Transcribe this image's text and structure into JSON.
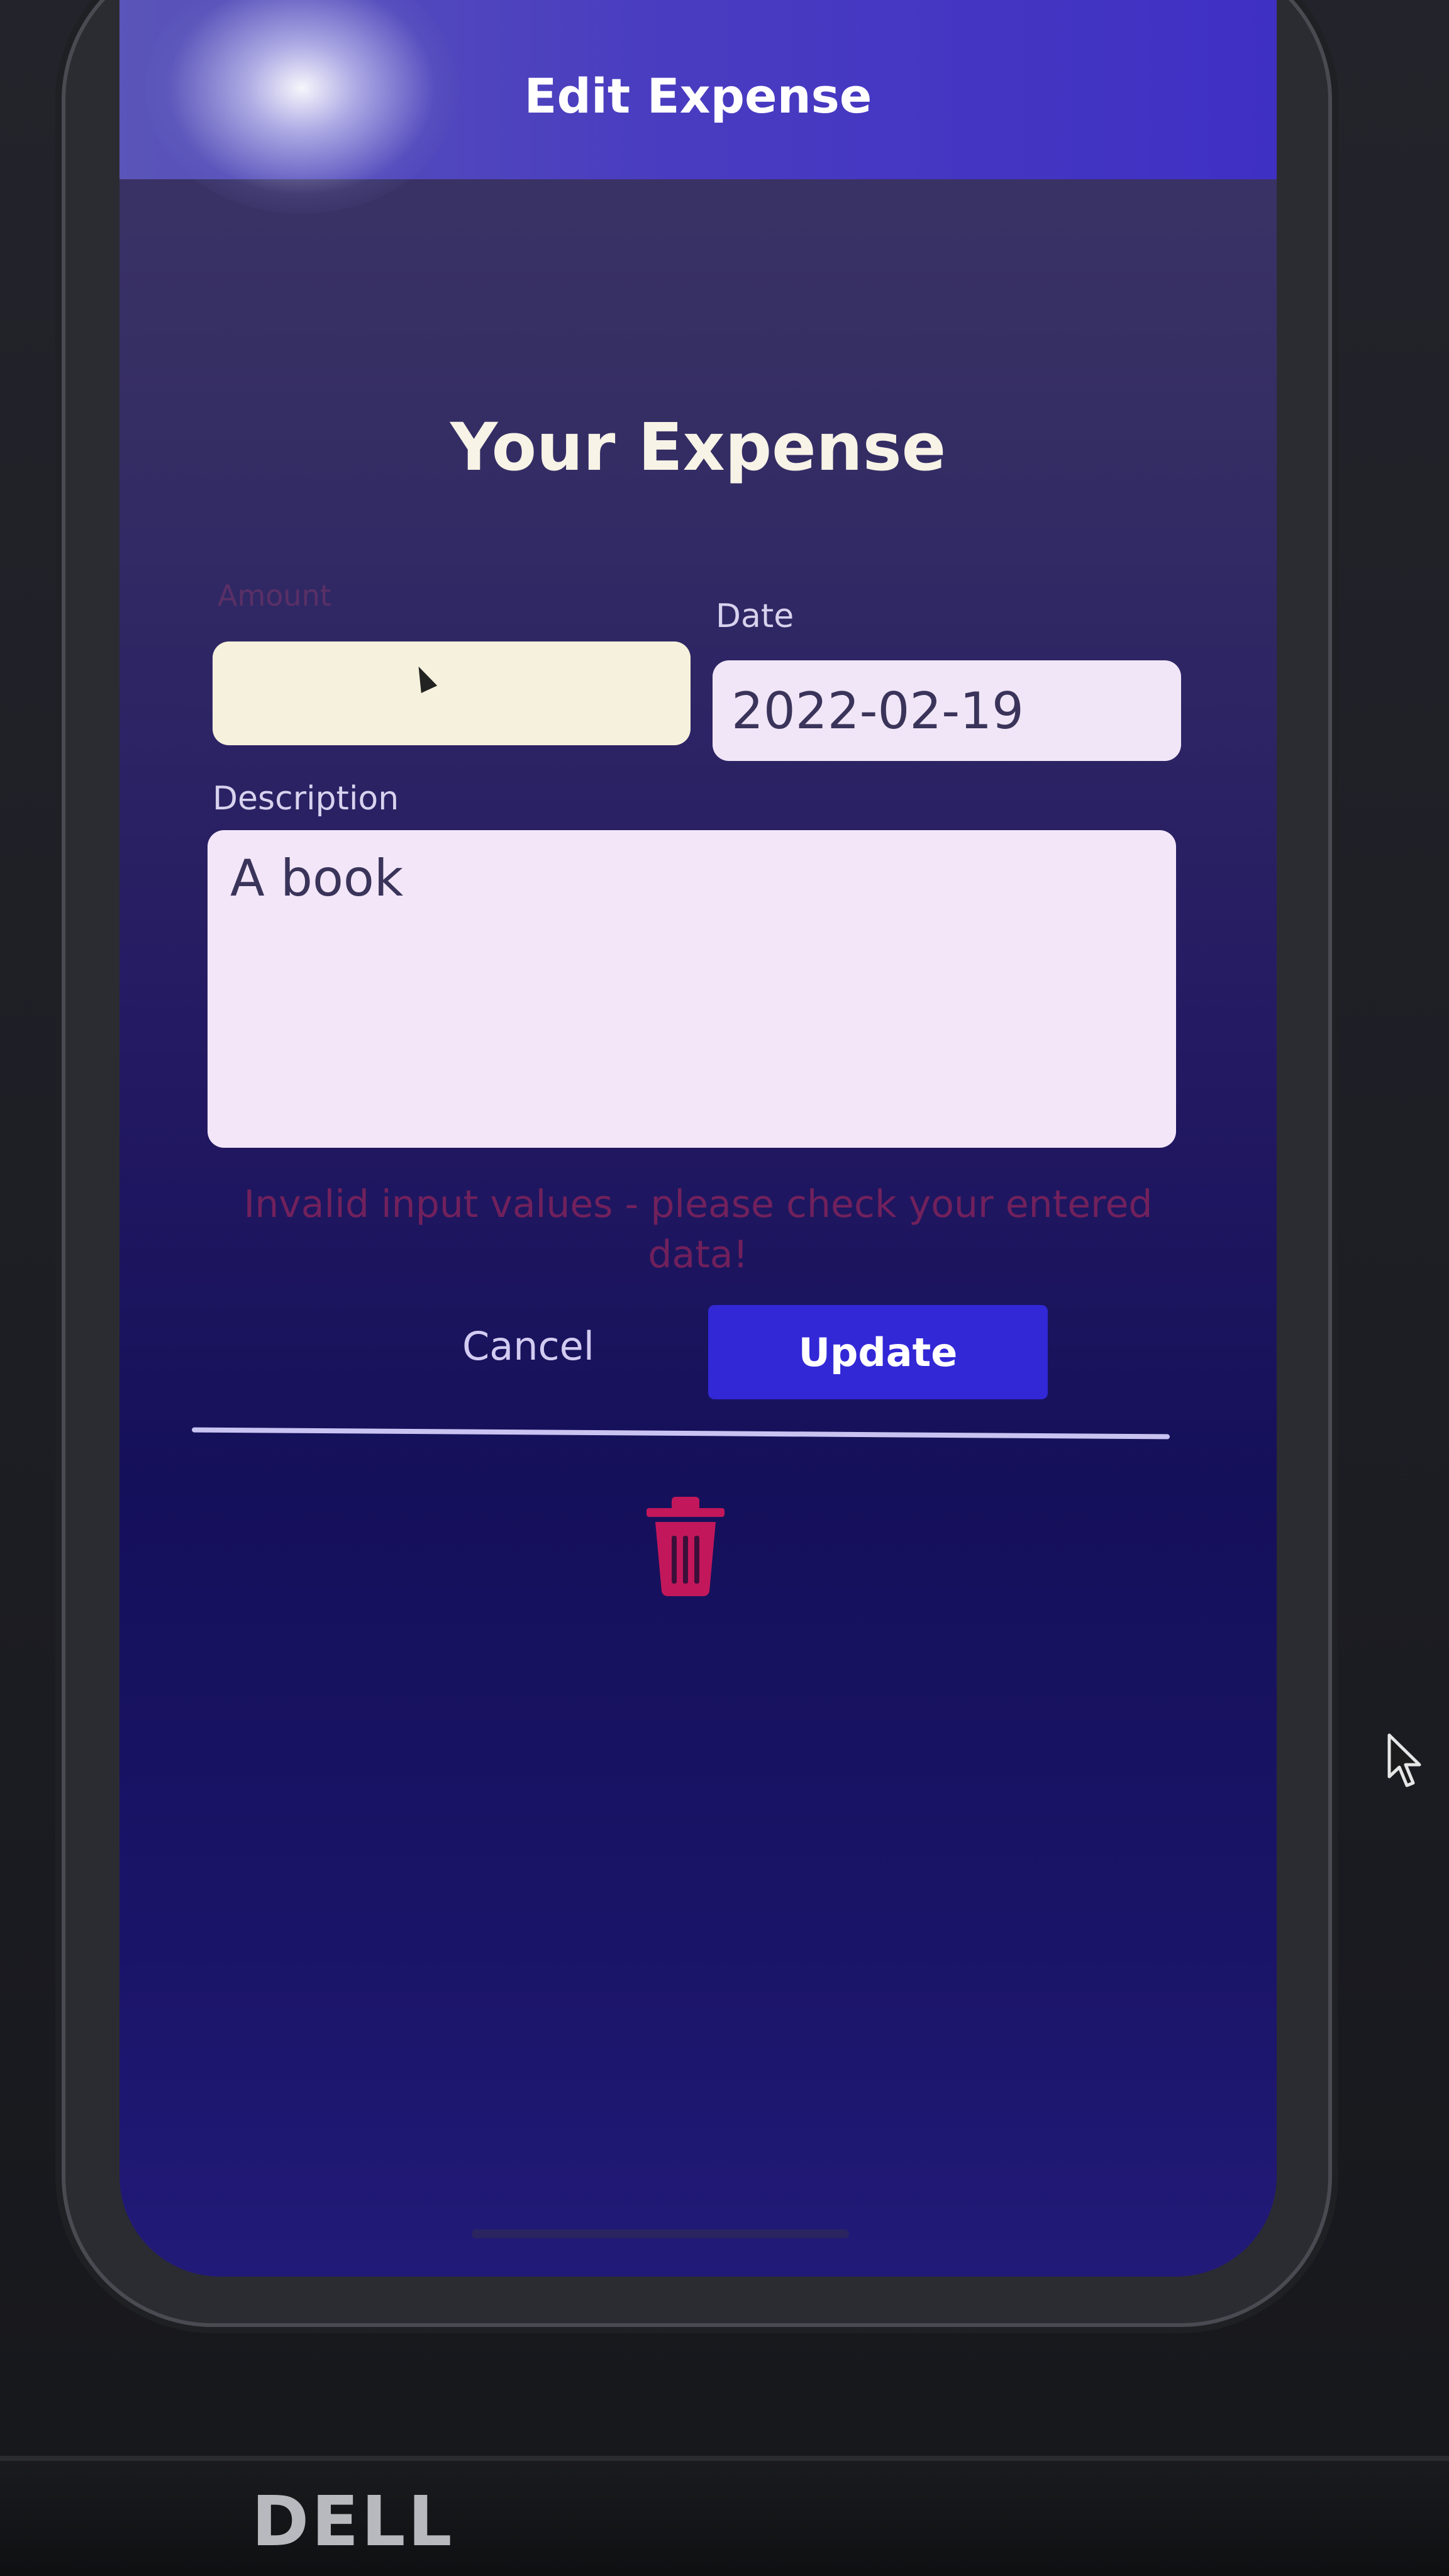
{
  "header": {
    "title": "Edit Expense"
  },
  "form": {
    "title": "Your Expense",
    "amount": {
      "label": "Amount",
      "value": ""
    },
    "date": {
      "label": "Date",
      "value": "2022-02-19"
    },
    "description": {
      "label": "Description",
      "value": "A book"
    },
    "error": "Invalid input values - please check your entered data!"
  },
  "actions": {
    "cancel_label": "Cancel",
    "update_label": "Update"
  },
  "delete": {
    "icon": "trash-icon",
    "color": "#c2185b"
  },
  "colors": {
    "accent": "#3228d6",
    "header": "#4a3dc0",
    "error": "#b62a5a"
  },
  "monitor": {
    "brand": "DELL"
  }
}
